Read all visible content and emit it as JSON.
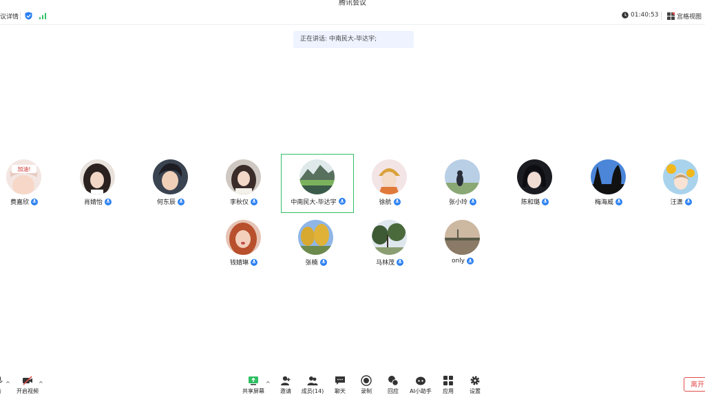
{
  "window": {
    "title": "腾讯会议"
  },
  "topbar": {
    "meeting_info_label": "议详情",
    "timer": "01:40:53",
    "view_label": "宫格视图",
    "shield_color": "#2a7ff2",
    "signal_color": "#2fbf63"
  },
  "speaking": {
    "text": "正在讲话: 中南民大-毕达宇;"
  },
  "participants": [
    {
      "name": "费嘉欣",
      "avatar": "girl-sticker-avatar"
    },
    {
      "name": "肖婧怡",
      "avatar": "girl-photo-avatar"
    },
    {
      "name": "何东辰",
      "avatar": "anime-boy-avatar"
    },
    {
      "name": "李秋仪",
      "avatar": "girl-portrait-avatar"
    },
    {
      "name": "中南民大-毕达宇",
      "avatar": "landscape-painting-avatar",
      "active": true
    },
    {
      "name": "徐航",
      "avatar": "cartoon-girl-avatar"
    },
    {
      "name": "张小玲",
      "avatar": "girl-field-avatar"
    },
    {
      "name": "陈和璐",
      "avatar": "anime-girl-avatar"
    },
    {
      "name": "梅海威",
      "avatar": "tree-sky-avatar"
    },
    {
      "name": "汪潇",
      "avatar": "sunflower-girl-avatar"
    },
    {
      "name": "钱婧琳",
      "avatar": "red-hair-avatar"
    },
    {
      "name": "张楠",
      "avatar": "autumn-trees-avatar"
    },
    {
      "name": "马林茂",
      "avatar": "park-trees-avatar"
    },
    {
      "name": "only",
      "avatar": "lake-sunset-avatar"
    }
  ],
  "toolbar": {
    "audio_label": "音",
    "video_label": "开启视频",
    "share_label": "共享屏幕",
    "invite_label": "邀请",
    "members_label": "成员(14)",
    "chat_label": "聊天",
    "record_label": "录制",
    "react_label": "回应",
    "ai_label": "AI小助手",
    "apps_label": "应用",
    "settings_label": "设置",
    "leave_label": "离开"
  }
}
